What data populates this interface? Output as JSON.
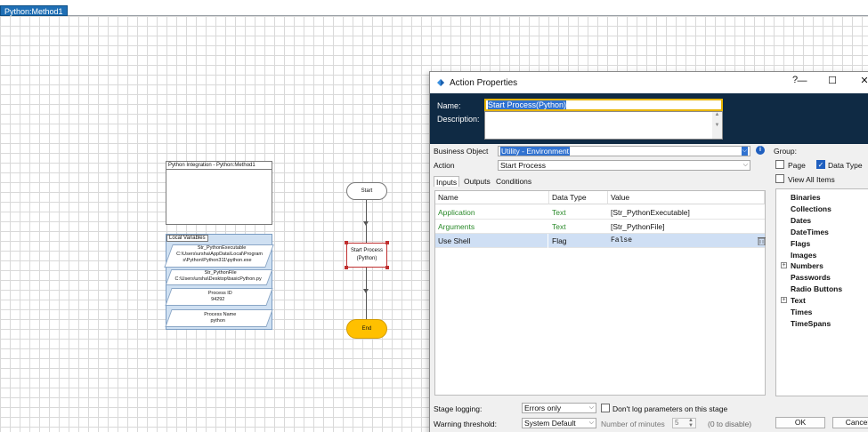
{
  "canvas": {
    "tab_label": "Python:Method1",
    "info_box_title": "Python Integration - Python:Method1",
    "local_variables_label": "Local Variables",
    "variables": [
      {
        "name": "Str_PythonExecutable",
        "value_line1": "C:\\Users\\ursha\\AppData\\Local\\Program",
        "value_line2": "s\\Python\\Python311\\python.exe"
      },
      {
        "name": "Str_PythonFile",
        "value_line1": "C:\\Users\\ursha\\Desktop\\basicPython.py"
      },
      {
        "name": "Process ID",
        "value_line1": "94292"
      },
      {
        "name": "Process Name",
        "value_line1": "python"
      }
    ],
    "start_label": "Start",
    "action_label_line1": "Start Process",
    "action_label_line2": "(Python)",
    "end_label": "End"
  },
  "dialog": {
    "title": "Action Properties",
    "help_btn": "?",
    "minimize_btn": "—",
    "maximize_btn": "☐",
    "close_btn": "✕",
    "name_label": "Name:",
    "name_value": "Start Process(Python)",
    "description_label": "Description:",
    "business_object_label": "Business Object",
    "business_object_value": "Utility - Environment",
    "action_label": "Action",
    "action_value": "Start Process",
    "tabs": [
      "Inputs",
      "Outputs",
      "Conditions"
    ],
    "grid_headers": [
      "Name",
      "Data Type",
      "Value"
    ],
    "grid_rows": [
      {
        "name": "Application",
        "type": "Text",
        "value": "[Str_PythonExecutable]"
      },
      {
        "name": "Arguments",
        "type": "Text",
        "value": "[Str_PythonFile]"
      },
      {
        "name": "Use Shell",
        "type": "Flag",
        "value": "False"
      }
    ],
    "group_label": "Group:",
    "page_label": "Page",
    "data_type_label": "Data Type",
    "view_all_label": "View All Items",
    "tree_items": [
      "Binaries",
      "Collections",
      "Dates",
      "DateTimes",
      "Flags",
      "Images",
      "Numbers",
      "Passwords",
      "Radio Buttons",
      "Text",
      "Times",
      "TimeSpans"
    ],
    "stage_logging_label": "Stage logging:",
    "stage_logging_value": "Errors only",
    "dont_log_label": "Don't log parameters on this stage",
    "warning_threshold_label": "Warning threshold:",
    "warning_threshold_value": "System Default",
    "number_of_minutes_label": "Number of minutes",
    "minutes_value": "5",
    "minutes_hint": "(0 to disable)",
    "ok_label": "OK",
    "cancel_label": "Cancel"
  },
  "colors": {
    "accent": "#1f6fb5",
    "header_bg": "#0f2a44",
    "end_node": "#ffc000",
    "selection": "#3072d0"
  }
}
